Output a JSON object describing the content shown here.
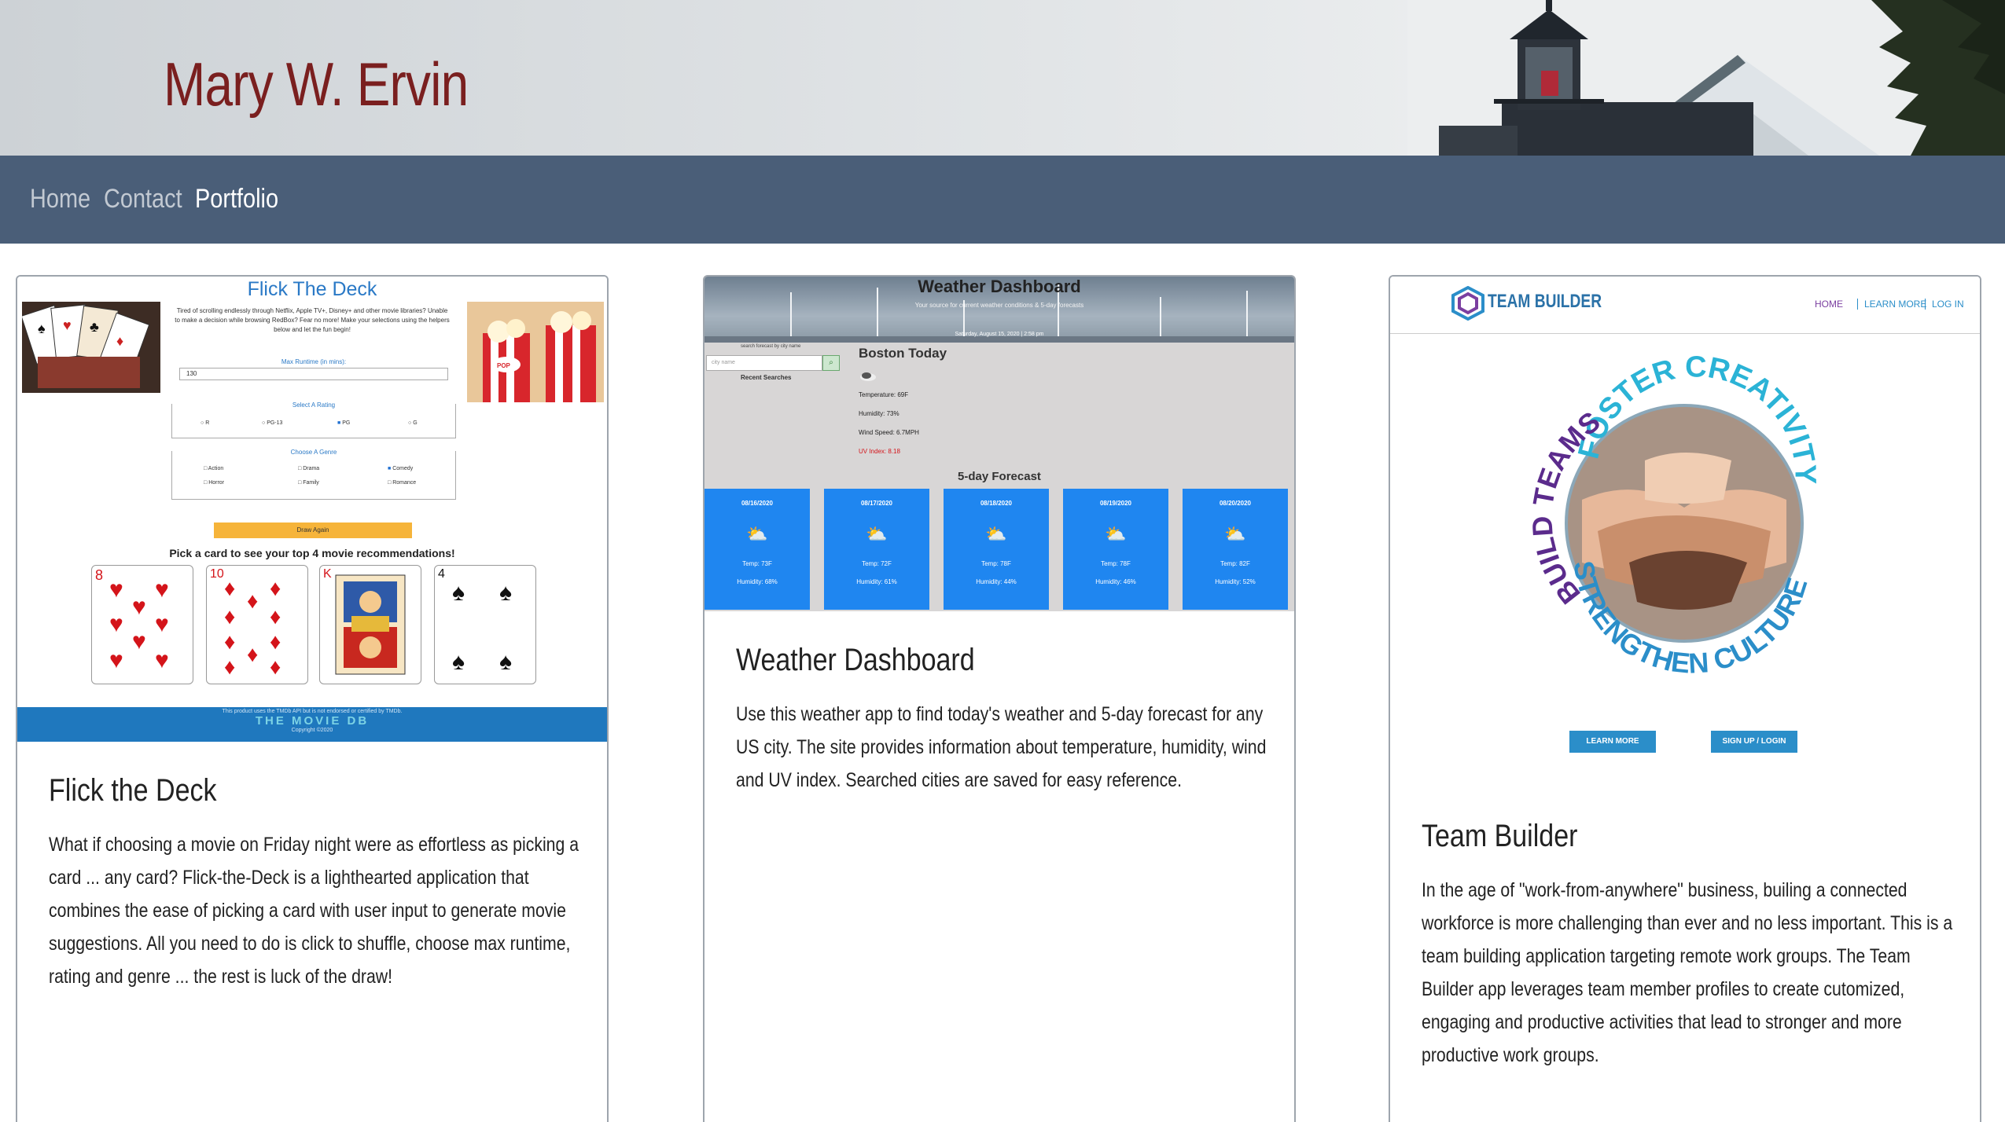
{
  "header": {
    "title": "Mary W. Ervin"
  },
  "nav": [
    {
      "label": "Home",
      "active": false
    },
    {
      "label": "Contact",
      "active": false
    },
    {
      "label": "Portfolio",
      "active": true
    }
  ],
  "cards": [
    {
      "title": "Flick the Deck",
      "description": "What if choosing a movie on Friday night were as effortless as picking a card ... any card? Flick-the-Deck is a lighthearted application that combines the ease of picking a card with user input to generate movie suggestions. All you need to do is click to shuffle, choose max runtime, rating and genre ... the rest is luck of the draw!",
      "shot": {
        "title": "Flick The Deck",
        "subtitle": "Tired of scrolling endlessly through Netflix, Apple TV+, Disney+ and other movie libraries? Unable to make a decision while browsing RedBox? Fear no more! Make your selections using the helpers below and let the fun begin!",
        "runtime_label": "Max Runtime (in mins):",
        "runtime_value": "130",
        "rating_label": "Select A Rating",
        "ratings": [
          "R",
          "PG-13",
          "PG",
          "G"
        ],
        "genre_label": "Choose A Genre",
        "genres": [
          "Action",
          "Drama",
          "Comedy",
          "Horror",
          "Family",
          "Romance"
        ],
        "button": "Draw Again",
        "pick_text": "Pick a card to see your top 4 movie recommendations!",
        "cards": [
          "8",
          "10",
          "K",
          "4"
        ],
        "footer_line": "This product uses the TMDb API but is not endorsed or certified by TMDb.",
        "footer_brand": "THE MOVIE DB",
        "footer_copy": "Copyright ©2020"
      }
    },
    {
      "title": "Weather Dashboard",
      "description": "Use this weather app to find today's weather and 5-day forecast for any US city. The site provides information about temperature, humidity, wind and UV index. Searched cities are saved for easy reference.",
      "shot": {
        "title": "Weather Dashboard",
        "tagline": "Your source for current weather conditions & 5-day forecasts",
        "date": "Saturday, August 15, 2020 | 2:58 pm",
        "search_label": "search forecast by city name",
        "search_placeholder": "city name",
        "recent": "Recent Searches",
        "city": "Boston Today",
        "temperature": "Temperature: 69F",
        "humidity": "Humidity: 73%",
        "wind": "Wind Speed: 6.7MPH",
        "uv": "UV Index: 8.18",
        "forecast_title": "5-day Forecast",
        "forecast": [
          {
            "date": "08/16/2020",
            "temp": "Temp: 73F",
            "humidity": "Humidity: 68%"
          },
          {
            "date": "08/17/2020",
            "temp": "Temp: 72F",
            "humidity": "Humidity: 61%"
          },
          {
            "date": "08/18/2020",
            "temp": "Temp: 78F",
            "humidity": "Humidity: 44%"
          },
          {
            "date": "08/19/2020",
            "temp": "Temp: 78F",
            "humidity": "Humidity: 46%"
          },
          {
            "date": "08/20/2020",
            "temp": "Temp: 82F",
            "humidity": "Humidity: 52%"
          }
        ]
      }
    },
    {
      "title": "Team Builder",
      "description": "In the age of \"work-from-anywhere\" business, builing a connected workforce is more challenging than ever and no less important. This is a team building application targeting remote work groups. The Team Builder app leverages team member profiles to create cutomized, engaging and productive activities that lead to stronger and more productive work groups.",
      "shot": {
        "brand": "TEAM BUILDER",
        "nav": [
          "HOME",
          "LEARN MORE",
          "LOG IN"
        ],
        "ring_top": "FOSTER CREATIVITY",
        "ring_left": "BUILD TEAMS",
        "ring_bottom": "STRENGTHEN CULTURE",
        "button_learn": "LEARN MORE",
        "button_login": "SIGN UP / LOGIN"
      }
    }
  ],
  "colors": {
    "title": "#7a1f1f",
    "nav_bg": "#4a5e78",
    "accent_blue": "#1f86f0"
  }
}
